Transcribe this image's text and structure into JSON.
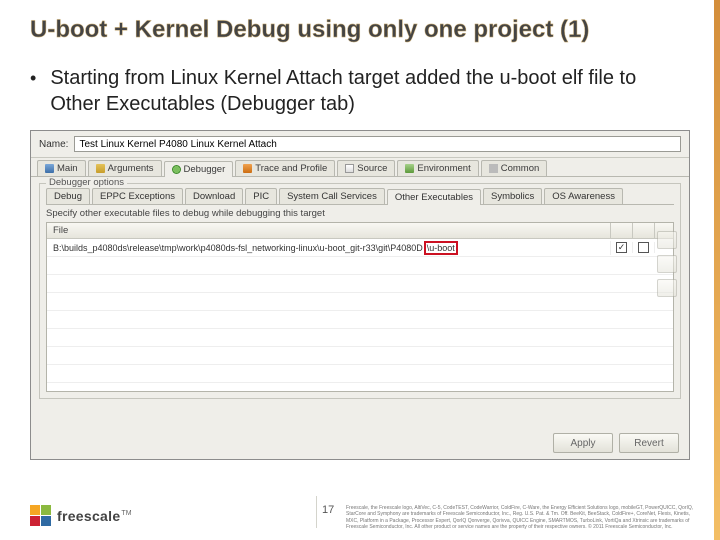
{
  "title": "U-boot + Kernel Debug using only one project (1)",
  "bullet": "Starting from Linux Kernel Attach target added the u-boot elf file to Other Executables (Debugger tab)",
  "dialog": {
    "name_label": "Name:",
    "name_value": "Test Linux Kernel P4080 Linux Kernel Attach",
    "main_tabs": [
      "Main",
      "Arguments",
      "Debugger",
      "Trace and Profile",
      "Source",
      "Environment",
      "Common"
    ],
    "active_main_tab": 2,
    "group_title": "Debugger options",
    "inner_tabs": [
      "Debug",
      "EPPC Exceptions",
      "Download",
      "PIC",
      "System Call Services",
      "Other Executables",
      "Symbolics",
      "OS Awareness"
    ],
    "active_inner_tab": 5,
    "instruction": "Specify other executable files to debug while debugging this target",
    "grid_header": "File",
    "row_path_prefix": "B:\\builds_p4080ds\\release\\tmp\\work\\p4080ds-fsl_networking-linux\\u-boot_git-r33\\git\\P4080D",
    "row_path_highlight": "\\u-boot",
    "checkbox1_checked": true,
    "checkbox2_checked": false,
    "buttons": {
      "apply": "Apply",
      "revert": "Revert"
    }
  },
  "footer": {
    "brand": "freescale",
    "tm": "TM",
    "page_number": "17",
    "legal": "Freescale, the Freescale logo, AltiVec, C-5, CodeTEST, CodeWarrior, ColdFire, C-Ware, the Energy Efficient Solutions logo, mobileGT, PowerQUICC, QorIQ, StarCore and Symphony are trademarks of Freescale Semiconductor, Inc., Reg. U.S. Pat. & Tm. Off. BeeKit, BeeStack, ColdFire+, CoreNet, Flexis, Kinetis, MXC, Platform in a Package, Processor Expert, QorIQ Qonverge, Qorivva, QUICC Engine, SMARTMOS, TurboLink, VortiQa and Xtrinsic are trademarks of Freescale Semiconductor, Inc. All other product or service names are the property of their respective owners. © 2011 Freescale Semiconductor, Inc."
  }
}
